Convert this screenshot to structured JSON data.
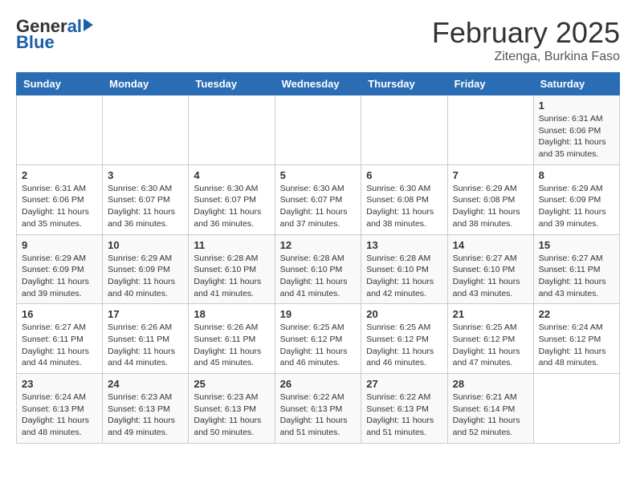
{
  "logo": {
    "general": "General",
    "blue": "Blue"
  },
  "title": {
    "month": "February 2025",
    "location": "Zitenga, Burkina Faso"
  },
  "days_of_week": [
    "Sunday",
    "Monday",
    "Tuesday",
    "Wednesday",
    "Thursday",
    "Friday",
    "Saturday"
  ],
  "weeks": [
    [
      {
        "day": "",
        "info": ""
      },
      {
        "day": "",
        "info": ""
      },
      {
        "day": "",
        "info": ""
      },
      {
        "day": "",
        "info": ""
      },
      {
        "day": "",
        "info": ""
      },
      {
        "day": "",
        "info": ""
      },
      {
        "day": "1",
        "info": "Sunrise: 6:31 AM\nSunset: 6:06 PM\nDaylight: 11 hours and 35 minutes."
      }
    ],
    [
      {
        "day": "2",
        "info": "Sunrise: 6:31 AM\nSunset: 6:06 PM\nDaylight: 11 hours and 35 minutes."
      },
      {
        "day": "3",
        "info": "Sunrise: 6:30 AM\nSunset: 6:07 PM\nDaylight: 11 hours and 36 minutes."
      },
      {
        "day": "4",
        "info": "Sunrise: 6:30 AM\nSunset: 6:07 PM\nDaylight: 11 hours and 36 minutes."
      },
      {
        "day": "5",
        "info": "Sunrise: 6:30 AM\nSunset: 6:07 PM\nDaylight: 11 hours and 37 minutes."
      },
      {
        "day": "6",
        "info": "Sunrise: 6:30 AM\nSunset: 6:08 PM\nDaylight: 11 hours and 38 minutes."
      },
      {
        "day": "7",
        "info": "Sunrise: 6:29 AM\nSunset: 6:08 PM\nDaylight: 11 hours and 38 minutes."
      },
      {
        "day": "8",
        "info": "Sunrise: 6:29 AM\nSunset: 6:09 PM\nDaylight: 11 hours and 39 minutes."
      }
    ],
    [
      {
        "day": "9",
        "info": "Sunrise: 6:29 AM\nSunset: 6:09 PM\nDaylight: 11 hours and 39 minutes."
      },
      {
        "day": "10",
        "info": "Sunrise: 6:29 AM\nSunset: 6:09 PM\nDaylight: 11 hours and 40 minutes."
      },
      {
        "day": "11",
        "info": "Sunrise: 6:28 AM\nSunset: 6:10 PM\nDaylight: 11 hours and 41 minutes."
      },
      {
        "day": "12",
        "info": "Sunrise: 6:28 AM\nSunset: 6:10 PM\nDaylight: 11 hours and 41 minutes."
      },
      {
        "day": "13",
        "info": "Sunrise: 6:28 AM\nSunset: 6:10 PM\nDaylight: 11 hours and 42 minutes."
      },
      {
        "day": "14",
        "info": "Sunrise: 6:27 AM\nSunset: 6:10 PM\nDaylight: 11 hours and 43 minutes."
      },
      {
        "day": "15",
        "info": "Sunrise: 6:27 AM\nSunset: 6:11 PM\nDaylight: 11 hours and 43 minutes."
      }
    ],
    [
      {
        "day": "16",
        "info": "Sunrise: 6:27 AM\nSunset: 6:11 PM\nDaylight: 11 hours and 44 minutes."
      },
      {
        "day": "17",
        "info": "Sunrise: 6:26 AM\nSunset: 6:11 PM\nDaylight: 11 hours and 44 minutes."
      },
      {
        "day": "18",
        "info": "Sunrise: 6:26 AM\nSunset: 6:11 PM\nDaylight: 11 hours and 45 minutes."
      },
      {
        "day": "19",
        "info": "Sunrise: 6:25 AM\nSunset: 6:12 PM\nDaylight: 11 hours and 46 minutes."
      },
      {
        "day": "20",
        "info": "Sunrise: 6:25 AM\nSunset: 6:12 PM\nDaylight: 11 hours and 46 minutes."
      },
      {
        "day": "21",
        "info": "Sunrise: 6:25 AM\nSunset: 6:12 PM\nDaylight: 11 hours and 47 minutes."
      },
      {
        "day": "22",
        "info": "Sunrise: 6:24 AM\nSunset: 6:12 PM\nDaylight: 11 hours and 48 minutes."
      }
    ],
    [
      {
        "day": "23",
        "info": "Sunrise: 6:24 AM\nSunset: 6:13 PM\nDaylight: 11 hours and 48 minutes."
      },
      {
        "day": "24",
        "info": "Sunrise: 6:23 AM\nSunset: 6:13 PM\nDaylight: 11 hours and 49 minutes."
      },
      {
        "day": "25",
        "info": "Sunrise: 6:23 AM\nSunset: 6:13 PM\nDaylight: 11 hours and 50 minutes."
      },
      {
        "day": "26",
        "info": "Sunrise: 6:22 AM\nSunset: 6:13 PM\nDaylight: 11 hours and 51 minutes."
      },
      {
        "day": "27",
        "info": "Sunrise: 6:22 AM\nSunset: 6:13 PM\nDaylight: 11 hours and 51 minutes."
      },
      {
        "day": "28",
        "info": "Sunrise: 6:21 AM\nSunset: 6:14 PM\nDaylight: 11 hours and 52 minutes."
      },
      {
        "day": "",
        "info": ""
      }
    ]
  ]
}
